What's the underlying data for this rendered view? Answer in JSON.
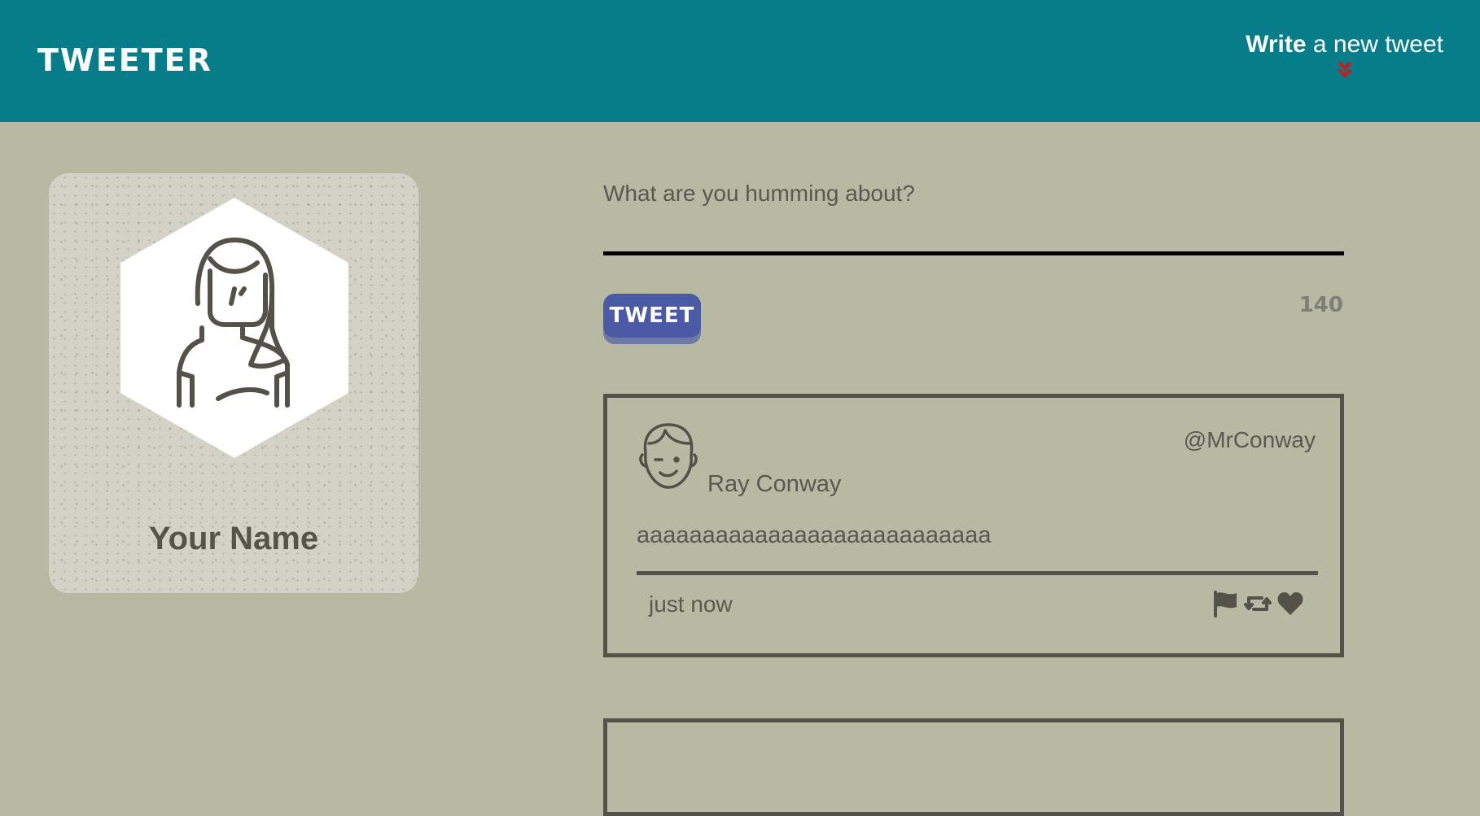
{
  "header": {
    "brand": "TWEETER",
    "compose_bold": "Write",
    "compose_rest": " a new tweet",
    "compose_icon": "double-chevron-down-icon",
    "compose_icon_color": "#cc1a1a"
  },
  "profile": {
    "name": "Your Name",
    "avatar_icon": "person-avatar-icon"
  },
  "composer": {
    "label": "What are you humming about?",
    "value": "",
    "button_label": "TWEET",
    "counter": "140"
  },
  "tweets": [
    {
      "handle": "@MrConway",
      "author": "Ray Conway",
      "content": "aaaaaaaaaaaaaaaaaaaaaaaaaaa",
      "timestamp": "just now",
      "actions": [
        "flag-icon",
        "retweet-icon",
        "heart-icon"
      ]
    }
  ],
  "colors": {
    "header_bg": "#087d8a",
    "page_bg": "#b7b9a2",
    "button_bg": "#4a5aa4",
    "text": "#545149"
  }
}
